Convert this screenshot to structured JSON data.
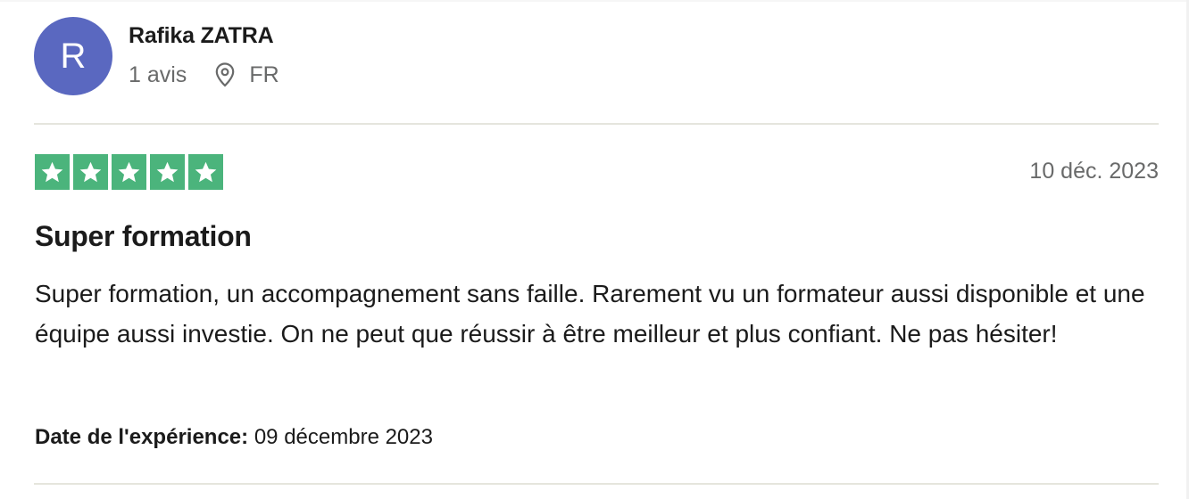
{
  "reviewer": {
    "avatar_initial": "R",
    "avatar_color": "#5a68c0",
    "name": "Rafika ZATRA",
    "review_count": "1 avis",
    "location_icon": "location-pin-icon",
    "country": "FR"
  },
  "review": {
    "rating": 5,
    "rating_max": 5,
    "star_color": "#4bb47c",
    "star_icon": "star-icon",
    "date": "10 déc. 2023",
    "title": "Super formation",
    "text": "Super formation, un accompagnement sans faille. Rarement vu un formateur aussi disponible et une équipe aussi investie. On ne peut que réussir à être meilleur et plus confiant. Ne pas hésiter!",
    "experience_label": "Date de l'expérience:",
    "experience_date": "09 décembre 2023"
  }
}
